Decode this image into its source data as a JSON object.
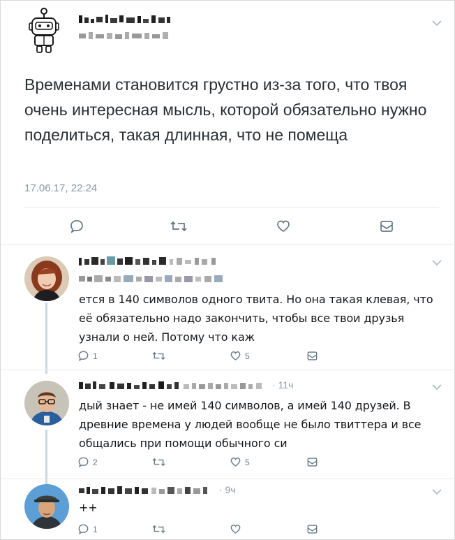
{
  "main_tweet": {
    "text": "Временами становится грустно из-за того, что твоя очень интересная мысль, которой обязательно нужно поделиться, такая длинная, что не помеща",
    "timestamp": "17.06.17, 22:24",
    "avatar_icon": "robot-icon"
  },
  "replies": [
    {
      "text": "ется в 140 символов одного твита. Но она такая клевая, что её обязательно надо закончить, чтобы все твои друзья узнали о ней. Потому что каж",
      "time": "",
      "reply_count": "1",
      "like_count": "5"
    },
    {
      "text": "дый знает - не имей 140 символов, а имей 140 друзей. В древние времена у людей вообще не было твиттера и все общались при помощи обычного си",
      "time": "· 11ч",
      "reply_count": "2",
      "like_count": "5"
    },
    {
      "text": "++",
      "time": "· 9ч",
      "reply_count": "1",
      "like_count": ""
    }
  ],
  "colors": {
    "text": "#14171a",
    "secondary": "#8899a6",
    "icon": "#657786",
    "divider": "#e6ecf0"
  }
}
